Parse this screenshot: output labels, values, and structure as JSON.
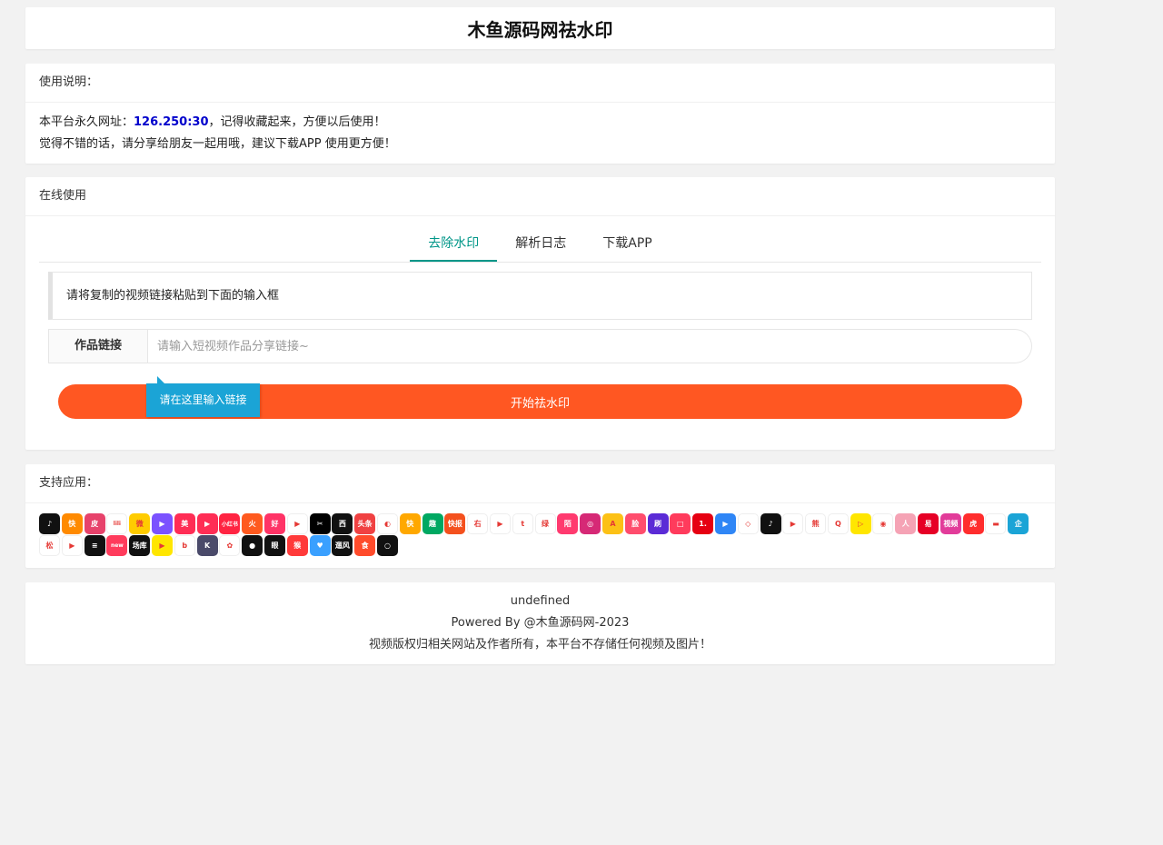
{
  "header": {
    "title": "木鱼源码网祛水印"
  },
  "usage": {
    "title": "使用说明：",
    "line1_prefix": "本平台永久网址：",
    "line1_highlight": "126.250:30",
    "line1_suffix": "，记得收藏起来，方便以后使用！",
    "line2": "觉得不错的话，请分享给朋友一起用哦，建议下载APP 使用更方便！"
  },
  "online": {
    "title": "在线使用",
    "tabs": [
      {
        "label": "去除水印",
        "active": true
      },
      {
        "label": "解析日志",
        "active": false
      },
      {
        "label": "下载APP",
        "active": false
      }
    ],
    "notice": "请将复制的视频链接粘贴到下面的输入框",
    "field_label": "作品链接",
    "input_placeholder": "请输入短视频作品分享链接~",
    "input_value": "",
    "tooltip": "请在这里输入链接",
    "start_button": "开始祛水印"
  },
  "apps": {
    "title": "支持应用：",
    "icons": [
      {
        "name": "douyin-icon",
        "color": "#111111",
        "label": "♪"
      },
      {
        "name": "kuaishou-icon",
        "color": "#ff8a00",
        "label": "快"
      },
      {
        "name": "pipixia-icon",
        "color": "#e7426b",
        "label": "皮"
      },
      {
        "name": "lishipin-icon",
        "color": "#ffffff",
        "label": "lili"
      },
      {
        "name": "weibo-icon",
        "color": "#ffcc00",
        "label": "微"
      },
      {
        "name": "weishi-icon",
        "color": "#7b52ff",
        "label": "▶"
      },
      {
        "name": "meipai-icon",
        "color": "#ff2d55",
        "label": "美"
      },
      {
        "name": "quanmin-icon",
        "color": "#ff2d55",
        "label": "▶"
      },
      {
        "name": "xiaohongshu-icon",
        "color": "#ff2442",
        "label": "小红书"
      },
      {
        "name": "huoshan-icon",
        "color": "#ff5a1f",
        "label": "火"
      },
      {
        "name": "haokan-icon",
        "color": "#ff3366",
        "label": "好"
      },
      {
        "name": "kuaikan-icon",
        "color": "#ffffff",
        "label": "▶"
      },
      {
        "name": "jianying-icon",
        "color": "#000000",
        "label": "✂"
      },
      {
        "name": "xigua-icon",
        "color": "#111111",
        "label": "西"
      },
      {
        "name": "toutiao-icon",
        "color": "#f04142",
        "label": "头条"
      },
      {
        "name": "weishi2-icon",
        "color": "#ffffff",
        "label": "◐"
      },
      {
        "name": "kuai-icon",
        "color": "#ffa800",
        "label": "快"
      },
      {
        "name": "qutoutiao-icon",
        "color": "#00a862",
        "label": "趣"
      },
      {
        "name": "kuaibao-icon",
        "color": "#f4511e",
        "label": "快报"
      },
      {
        "name": "zuiyou-icon",
        "color": "#ffffff",
        "label": "右"
      },
      {
        "name": "boba-icon",
        "color": "#ffffff",
        "label": "▶"
      },
      {
        "name": "twitter-icon",
        "color": "#ffffff",
        "label": "t"
      },
      {
        "name": "lvzhou-icon",
        "color": "#ffffff",
        "label": "绿"
      },
      {
        "name": "momo-icon",
        "color": "#ff3a6f",
        "label": "陌"
      },
      {
        "name": "instagram-icon",
        "color": "#d62976",
        "label": "◎"
      },
      {
        "name": "acfun-icon",
        "color": "#fcc116",
        "label": "A"
      },
      {
        "name": "face-icon",
        "color": "#ff4d6d",
        "label": "脸"
      },
      {
        "name": "shua-icon",
        "color": "#5b2bd6",
        "label": "刷"
      },
      {
        "name": "bobo-icon",
        "color": "#ff3b5c",
        "label": "□"
      },
      {
        "name": "yidian-icon",
        "color": "#e60012",
        "label": "1."
      },
      {
        "name": "youku-icon",
        "color": "#2f86f6",
        "label": "▶"
      },
      {
        "name": "iqiyi-icon",
        "color": "#ffffff",
        "label": "◇"
      },
      {
        "name": "tiktok-icon",
        "color": "#111111",
        "label": "♪"
      },
      {
        "name": "youtube-icon",
        "color": "#ffffff",
        "label": "▶"
      },
      {
        "name": "panda-icon",
        "color": "#ffffff",
        "label": "熊"
      },
      {
        "name": "qq-icon",
        "color": "#ffffff",
        "label": "Q"
      },
      {
        "name": "kankan-icon",
        "color": "#ffe600",
        "label": "▷"
      },
      {
        "name": "camera-icon",
        "color": "#ffffff",
        "label": "◉"
      },
      {
        "name": "avatar-icon",
        "color": "#f5a3b5",
        "label": "人"
      },
      {
        "name": "netease-icon",
        "color": "#e60026",
        "label": "易"
      },
      {
        "name": "video-icon",
        "color": "#e23c9a",
        "label": "视频"
      },
      {
        "name": "tiger-icon",
        "color": "#ff2d2d",
        "label": "虎"
      },
      {
        "name": "bowl-icon",
        "color": "#ffffff",
        "label": "▬"
      },
      {
        "name": "penguin-icon",
        "color": "#1ba4d6",
        "label": "企"
      },
      {
        "name": "squirrel-icon",
        "color": "#ffffff",
        "label": "松"
      },
      {
        "name": "triangle-icon",
        "color": "#ffffff",
        "label": "▶"
      },
      {
        "name": "stripes-icon",
        "color": "#111111",
        "label": "≡"
      },
      {
        "name": "new-icon",
        "color": "#ff3b5c",
        "label": "new"
      },
      {
        "name": "changku-icon",
        "color": "#111111",
        "label": "场库"
      },
      {
        "name": "yellowplay-icon",
        "color": "#ffe600",
        "label": "▶"
      },
      {
        "name": "b-icon",
        "color": "#ffffff",
        "label": "b"
      },
      {
        "name": "k-icon",
        "color": "#4a4a6a",
        "label": "K"
      },
      {
        "name": "flower-icon",
        "color": "#ffffff",
        "label": "✿"
      },
      {
        "name": "round-icon",
        "color": "#111111",
        "label": "●"
      },
      {
        "name": "eyes-icon",
        "color": "#111111",
        "label": "眼"
      },
      {
        "name": "monkey-icon",
        "color": "#ff3a3a",
        "label": "猴"
      },
      {
        "name": "heart-icon",
        "color": "#3aa0ff",
        "label": "♥"
      },
      {
        "name": "fengyun-icon",
        "color": "#111111",
        "label": "遛风"
      },
      {
        "name": "shi-icon",
        "color": "#ff4b2b",
        "label": "食"
      },
      {
        "name": "ring-icon",
        "color": "#111111",
        "label": "○"
      }
    ]
  },
  "footer": {
    "line1": "undefined",
    "line2": "Powered By @木鱼源码网-2023",
    "line3": "视频版权归相关网站及作者所有，本平台不存储任何视频及图片！"
  }
}
